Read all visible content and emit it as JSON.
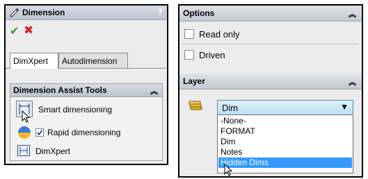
{
  "left_panel": {
    "title": "Dimension",
    "help_label": "?",
    "ok_symbol": "✔",
    "cancel_symbol": "✖",
    "tabs": [
      {
        "label": "DimXpert"
      },
      {
        "label": "Autodimension"
      }
    ],
    "assist_tools": {
      "title": "Dimension Assist Tools",
      "items": [
        {
          "label": "Smart dimensioning",
          "icon": "smart-dimension-icon"
        },
        {
          "label": "Rapid dimensioning",
          "icon": "rapid-dimension-icon",
          "checked": true
        },
        {
          "label": "DimXpert",
          "icon": "dimxpert-icon"
        }
      ]
    }
  },
  "right_panel": {
    "options": {
      "title": "Options",
      "items": [
        {
          "label": "Read only",
          "checked": false
        },
        {
          "label": "Driven",
          "checked": false
        }
      ]
    },
    "layer": {
      "title": "Layer",
      "icon": "layer-stack-icon",
      "selected": "Dim",
      "options": [
        "-None-",
        "FORMAT",
        "Dim",
        "Notes",
        "Hidden Dims"
      ],
      "highlighted": "Hidden Dims"
    }
  },
  "colors": {
    "header_gradient": "#c3c9d2",
    "ok_green": "#2e9a2e",
    "cancel_red": "#dd2222",
    "selection_blue": "#3399ff",
    "combo_blue": "#bcdff3"
  }
}
